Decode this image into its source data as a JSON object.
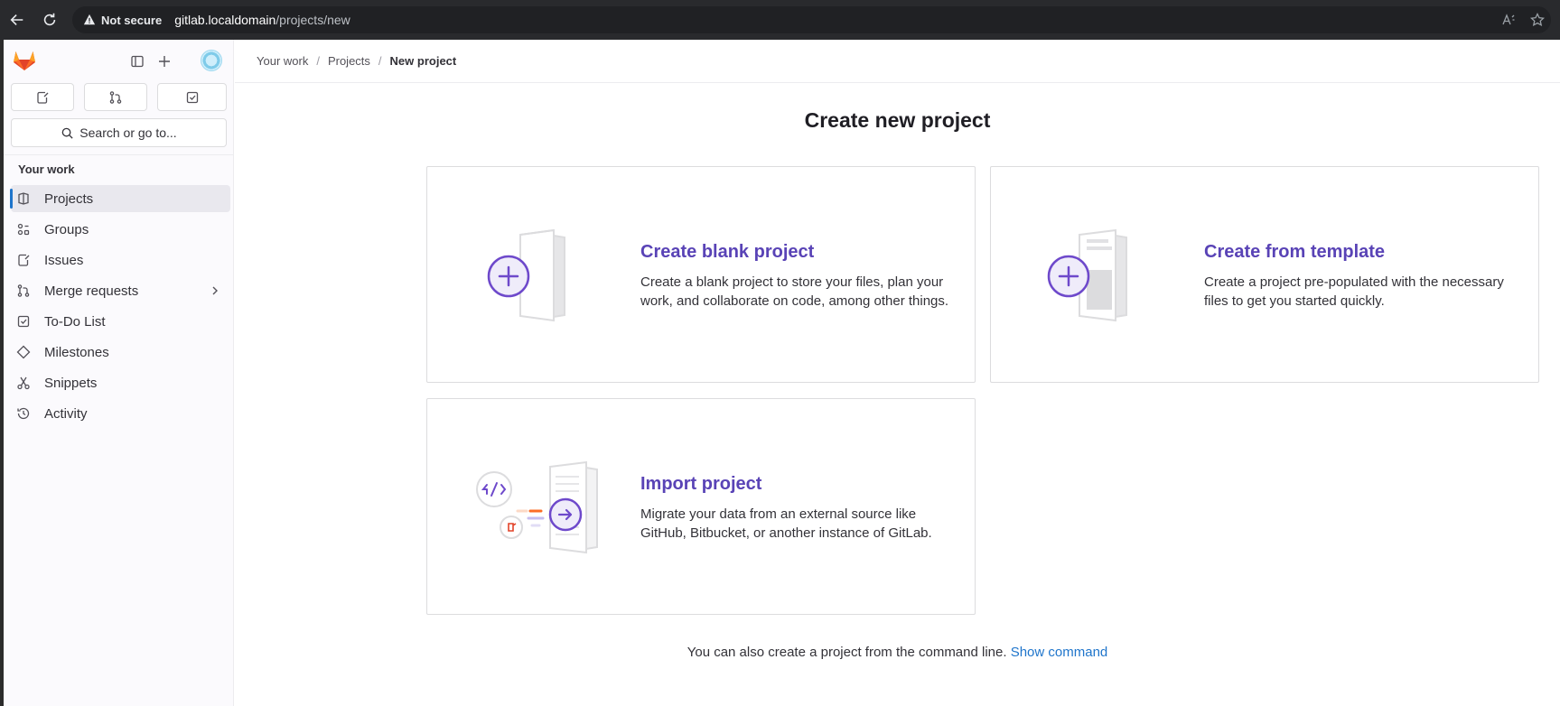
{
  "browser": {
    "security_label": "Not secure",
    "url_host": "gitlab.localdomain",
    "url_path": "/projects/new"
  },
  "sidebar": {
    "search_label": "Search or go to...",
    "section_title": "Your work",
    "items": [
      {
        "label": "Projects",
        "icon": "project-icon",
        "active": true
      },
      {
        "label": "Groups",
        "icon": "group-icon"
      },
      {
        "label": "Issues",
        "icon": "issues-icon"
      },
      {
        "label": "Merge requests",
        "icon": "merge-request-icon",
        "has_submenu": true
      },
      {
        "label": "To-Do List",
        "icon": "todo-icon"
      },
      {
        "label": "Milestones",
        "icon": "milestone-icon"
      },
      {
        "label": "Snippets",
        "icon": "snippet-icon"
      },
      {
        "label": "Activity",
        "icon": "history-icon"
      }
    ]
  },
  "breadcrumb": [
    "Your work",
    "Projects",
    "New project"
  ],
  "main": {
    "title": "Create new project",
    "cards": {
      "blank": {
        "title": "Create blank project",
        "description": "Create a blank project to store your files, plan your work, and collaborate on code, among other things."
      },
      "template": {
        "title": "Create from template",
        "description": "Create a project pre-populated with the necessary files to get you started quickly."
      },
      "import": {
        "title": "Import project",
        "description": "Migrate your data from an external source like GitHub, Bitbucket, or another instance of GitLab."
      }
    },
    "cli_note": "You can also create a project from the command line.",
    "cli_link": "Show command"
  },
  "colors": {
    "accent_purple": "#5943b6",
    "link_blue": "#1f75cb",
    "active_indicator": "#1f75cb"
  }
}
